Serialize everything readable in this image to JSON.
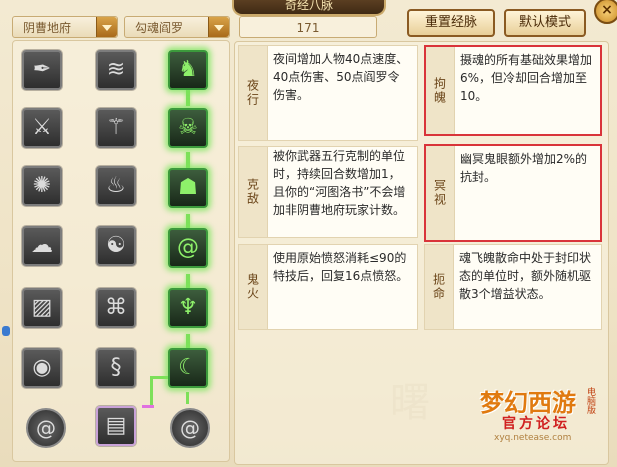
{
  "title": "奇经八脉",
  "close_label": "×",
  "filters": {
    "faction": "阴曹地府",
    "branch": "勾魂阎罗",
    "level": "171"
  },
  "buttons": {
    "reset": "重置经脉",
    "default_mode": "默认模式"
  },
  "slots": {
    "left_col": [
      "weapon-icon",
      "claw-icon",
      "fire-swirl-icon",
      "cloud-icon",
      "rune-tablet-icon",
      "eye-swirl-icon"
    ],
    "mid_col": [
      "wave-icon",
      "spear-rune-icon",
      "flame-scroll-icon",
      "ghost-icon",
      "knot-icon",
      "dragon-icon"
    ],
    "path_col": [
      "running-man-icon",
      "skull-spikes-icon",
      "ghost-mask-icon",
      "spiral-icon",
      "flames-icon",
      "crescent-icon"
    ],
    "bottom": [
      "spiral-orb-icon",
      "rune-gate-icon",
      "spiral-orb-icon"
    ]
  },
  "descriptions": [
    {
      "label": "夜行",
      "text": "夜间增加人物40点速度、40点伤害、50点阎罗令伤害。"
    },
    {
      "label": "拘魄",
      "text": "摄魂的所有基础效果增加6%，但冷却回合增加至10。"
    },
    {
      "label": "克敌",
      "text": "被你武器五行克制的单位时，持续回合数增加1，且你的“河图洛书”不会增加非阴曹地府玩家计数。"
    },
    {
      "label": "冥视",
      "text": "幽冥鬼眼额外增加2%的抗封。"
    },
    {
      "label": "鬼火",
      "text": "使用原始愤怒消耗≤90的特技后，回复16点愤怒。"
    },
    {
      "label": "扼命",
      "text": "魂飞魄散命中处于封印状态的单位时，额外随机驱散3个增益状态。"
    }
  ],
  "logo": {
    "main": "梦幻西游",
    "sub": "官方论坛",
    "tag": "电脑版",
    "url": "xyq.netease.com"
  },
  "colors": {
    "highlight_border": "#d9343a",
    "active_glow": "#7ee05a",
    "accent": "#c98a24"
  }
}
